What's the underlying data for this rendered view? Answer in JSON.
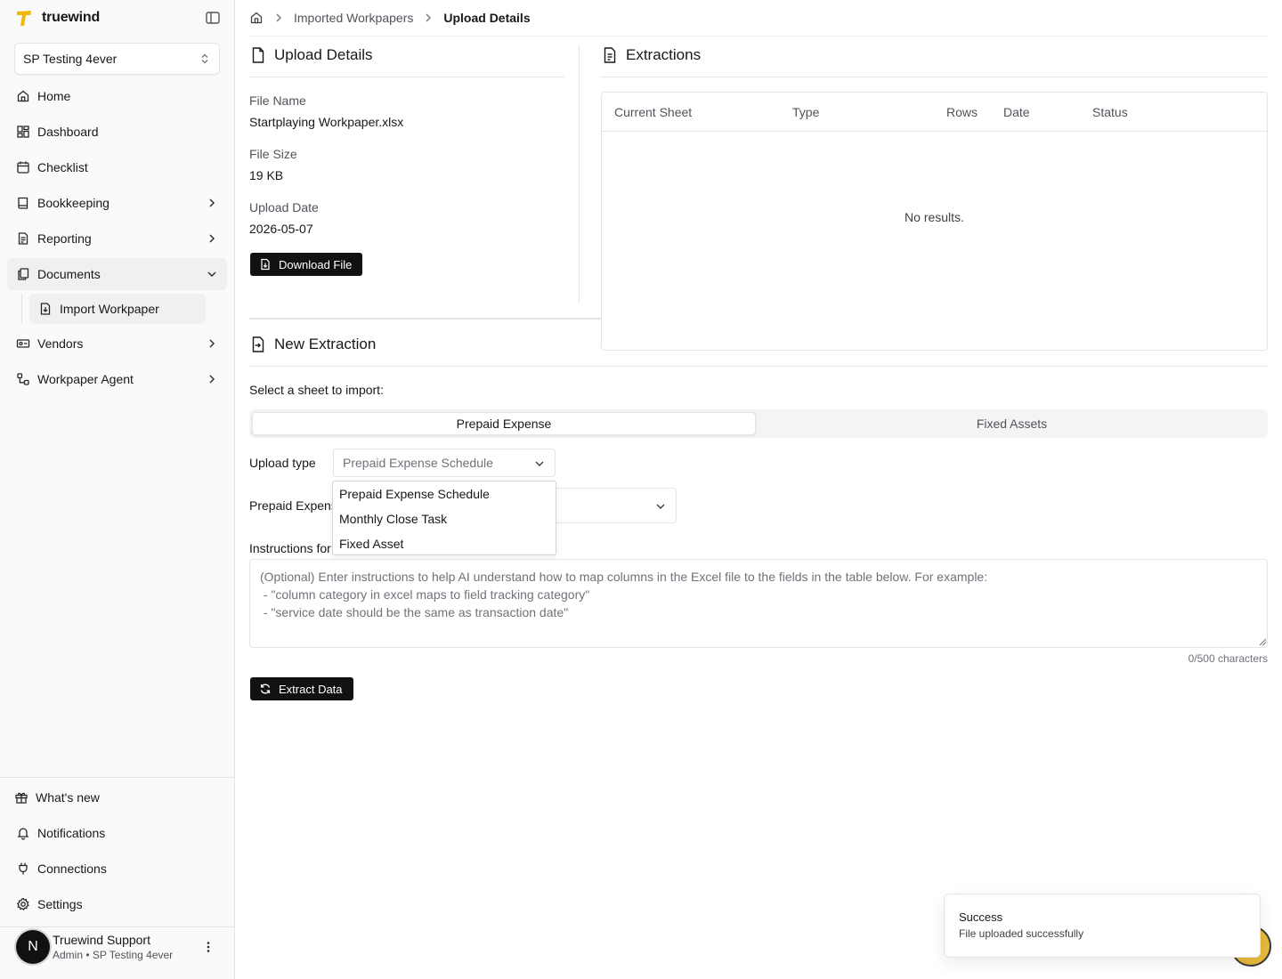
{
  "brand": {
    "name": "truewind",
    "accent": "#f2b705"
  },
  "org": {
    "selected": "SP Testing 4ever"
  },
  "nav": {
    "home": "Home",
    "dashboard": "Dashboard",
    "checklist": "Checklist",
    "bookkeeping": "Bookkeeping",
    "reporting": "Reporting",
    "documents": "Documents",
    "import_workpaper": "Import Workpaper",
    "vendors": "Vendors",
    "workpaper_agent": "Workpaper Agent"
  },
  "footer_nav": {
    "whats_new": "What's new",
    "notifications": "Notifications",
    "connections": "Connections",
    "settings": "Settings"
  },
  "user": {
    "initial": "N",
    "name": "Truewind Support",
    "role": "Admin • SP Testing 4ever"
  },
  "breadcrumb": {
    "parent": "Imported Workpapers",
    "current": "Upload Details"
  },
  "upload_details": {
    "title": "Upload Details",
    "file_name_label": "File Name",
    "file_name": "Startplaying Workpaper.xlsx",
    "file_size_label": "File Size",
    "file_size": "19 KB",
    "upload_date_label": "Upload Date",
    "upload_date": "2026-05-07",
    "download_label": "Download File"
  },
  "extractions": {
    "title": "Extractions",
    "columns": [
      "Current Sheet",
      "Type",
      "Rows",
      "Date",
      "Status"
    ],
    "empty": "No results."
  },
  "new_extraction": {
    "title": "New Extraction",
    "select_sheet_label": "Select a sheet to import:",
    "tabs": [
      "Prepaid Expense",
      "Fixed Assets"
    ],
    "upload_type_label": "Upload type",
    "upload_type_value": "Prepaid Expense Schedule",
    "upload_type_options": [
      "Prepaid Expense Schedule",
      "Monthly Close Task",
      "Fixed Asset"
    ],
    "prepaid_label": "Prepaid Expens",
    "instructions_label": "Instructions for",
    "instructions_placeholder": "(Optional) Enter instructions to help AI understand how to map columns in the Excel file to the fields in the table below. For example:\n - \"column category in excel maps to field tracking category\"\n - \"service date should be the same as transaction date\"",
    "char_count": "0/500 characters",
    "extract_label": "Extract Data"
  },
  "toast": {
    "title": "Success",
    "message": "File uploaded successfully"
  }
}
